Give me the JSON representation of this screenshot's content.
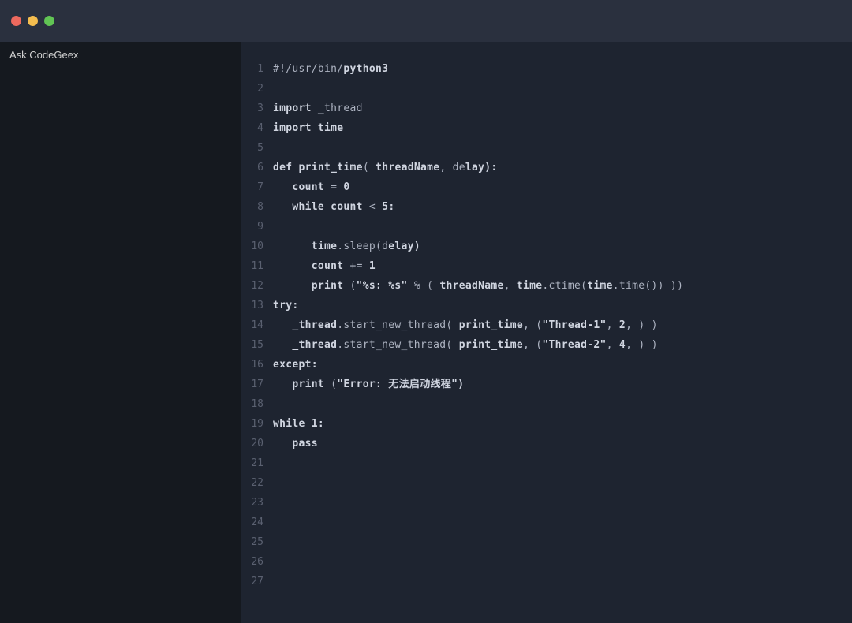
{
  "sidebar": {
    "tab_label": "Ask CodeGeex"
  },
  "code": {
    "total_lines": 27,
    "lines": [
      {
        "num": 1,
        "segments": [
          {
            "text": "#!/usr/bin/",
            "bold": false
          },
          {
            "text": "python3",
            "bold": true
          }
        ]
      },
      {
        "num": 2,
        "segments": []
      },
      {
        "num": 3,
        "segments": [
          {
            "text": "import",
            "bold": true
          },
          {
            "text": " _thread",
            "bold": false
          }
        ]
      },
      {
        "num": 4,
        "segments": [
          {
            "text": "import",
            "bold": true
          },
          {
            "text": " ",
            "bold": false
          },
          {
            "text": "time",
            "bold": true
          }
        ]
      },
      {
        "num": 5,
        "segments": []
      },
      {
        "num": 6,
        "segments": [
          {
            "text": "def",
            "bold": true
          },
          {
            "text": " ",
            "bold": false
          },
          {
            "text": "print_time",
            "bold": true
          },
          {
            "text": "( ",
            "bold": false
          },
          {
            "text": "threadName",
            "bold": true
          },
          {
            "text": ", de",
            "bold": false
          },
          {
            "text": "lay):",
            "bold": true
          }
        ]
      },
      {
        "num": 7,
        "segments": [
          {
            "text": "   count",
            "bold": true
          },
          {
            "text": " = ",
            "bold": false
          },
          {
            "text": "0",
            "bold": true
          }
        ]
      },
      {
        "num": 8,
        "segments": [
          {
            "text": "   while",
            "bold": true
          },
          {
            "text": " ",
            "bold": false
          },
          {
            "text": "count",
            "bold": true
          },
          {
            "text": " < ",
            "bold": false
          },
          {
            "text": "5:",
            "bold": true
          }
        ]
      },
      {
        "num": 9,
        "segments": []
      },
      {
        "num": 10,
        "segments": [
          {
            "text": "      ",
            "bold": false
          },
          {
            "text": "time",
            "bold": true
          },
          {
            "text": ".sleep(d",
            "bold": false
          },
          {
            "text": "elay)",
            "bold": true
          }
        ]
      },
      {
        "num": 11,
        "segments": [
          {
            "text": "      count",
            "bold": true
          },
          {
            "text": " += ",
            "bold": false
          },
          {
            "text": "1",
            "bold": true
          }
        ]
      },
      {
        "num": 12,
        "segments": [
          {
            "text": "      print",
            "bold": true
          },
          {
            "text": " (",
            "bold": false
          },
          {
            "text": "\"%s: %s\"",
            "bold": true
          },
          {
            "text": " % ( ",
            "bold": false
          },
          {
            "text": "threadName",
            "bold": true
          },
          {
            "text": ", ",
            "bold": false
          },
          {
            "text": "time",
            "bold": true
          },
          {
            "text": ".ctime(",
            "bold": false
          },
          {
            "text": "time",
            "bold": true
          },
          {
            "text": ".time()) ))",
            "bold": false
          }
        ]
      },
      {
        "num": 13,
        "segments": [
          {
            "text": "try:",
            "bold": true
          }
        ]
      },
      {
        "num": 14,
        "segments": [
          {
            "text": "   ",
            "bold": false
          },
          {
            "text": "_thread",
            "bold": true
          },
          {
            "text": ".start_new_thread( ",
            "bold": false
          },
          {
            "text": "print_time",
            "bold": true
          },
          {
            "text": ", (",
            "bold": false
          },
          {
            "text": "\"Thread-1\"",
            "bold": true
          },
          {
            "text": ", ",
            "bold": false
          },
          {
            "text": "2",
            "bold": true
          },
          {
            "text": ", ) )",
            "bold": false
          }
        ]
      },
      {
        "num": 15,
        "segments": [
          {
            "text": "   ",
            "bold": false
          },
          {
            "text": "_thread",
            "bold": true
          },
          {
            "text": ".start_new_thread( ",
            "bold": false
          },
          {
            "text": "print_time",
            "bold": true
          },
          {
            "text": ", (",
            "bold": false
          },
          {
            "text": "\"Thread-2\"",
            "bold": true
          },
          {
            "text": ", ",
            "bold": false
          },
          {
            "text": "4",
            "bold": true
          },
          {
            "text": ", ) )",
            "bold": false
          }
        ]
      },
      {
        "num": 16,
        "segments": [
          {
            "text": "except:",
            "bold": true
          }
        ]
      },
      {
        "num": 17,
        "segments": [
          {
            "text": "   ",
            "bold": false
          },
          {
            "text": "print",
            "bold": true
          },
          {
            "text": " (",
            "bold": false
          },
          {
            "text": "\"Error: 无法启动线程\")",
            "bold": true
          }
        ]
      },
      {
        "num": 18,
        "segments": []
      },
      {
        "num": 19,
        "segments": [
          {
            "text": "while",
            "bold": true
          },
          {
            "text": " ",
            "bold": false
          },
          {
            "text": "1:",
            "bold": true
          }
        ]
      },
      {
        "num": 20,
        "segments": [
          {
            "text": "   ",
            "bold": false
          },
          {
            "text": "pass",
            "bold": true
          }
        ]
      },
      {
        "num": 21,
        "segments": []
      },
      {
        "num": 22,
        "segments": []
      },
      {
        "num": 23,
        "segments": []
      },
      {
        "num": 24,
        "segments": []
      },
      {
        "num": 25,
        "segments": []
      },
      {
        "num": 26,
        "segments": []
      },
      {
        "num": 27,
        "segments": []
      }
    ]
  }
}
